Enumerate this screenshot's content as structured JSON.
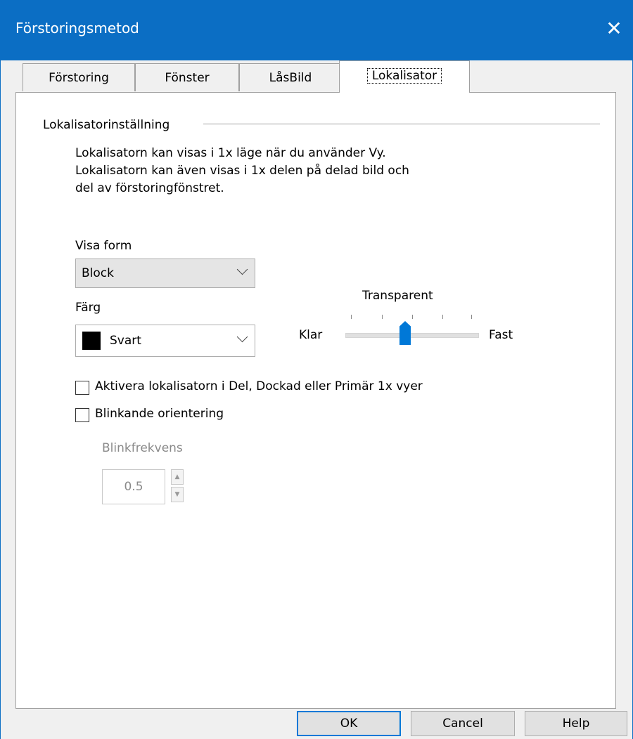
{
  "window": {
    "title": "Förstoringsmetod",
    "close_glyph": "✕"
  },
  "tabs": [
    {
      "label": "Förstoring"
    },
    {
      "label": "Fönster"
    },
    {
      "label": "LåsBild"
    },
    {
      "label": "Lokalisator",
      "active": true
    }
  ],
  "group": {
    "label": "Lokalisatorinställning",
    "description": [
      "Lokalisatorn kan visas i 1x läge när du använder Vy.",
      "Lokalisatorn kan även visas i 1x delen på delad bild och",
      "del av förstoringfönstret."
    ]
  },
  "shape": {
    "label": "Visa form",
    "value": "Block"
  },
  "color": {
    "label": "Färg",
    "value": "Svart",
    "swatch": "#000000"
  },
  "transparency": {
    "label": "Transparent",
    "min_label": "Klar",
    "max_label": "Fast",
    "level_fraction": 0.5
  },
  "checkboxes": [
    {
      "label": "Aktivera lokalisatorn i Del, Dockad eller Primär 1x vyer",
      "checked": false
    },
    {
      "label": "Blinkande orientering",
      "checked": false
    }
  ],
  "blink": {
    "label": "Blinkfrekvens",
    "value": "0.5"
  },
  "buttons": {
    "ok": "OK",
    "cancel": "Cancel",
    "help": "Help"
  },
  "colors": {
    "titlebar": "#0b6ec4",
    "slider_thumb": "#0078d7",
    "default_button_border": "#0078d7"
  }
}
